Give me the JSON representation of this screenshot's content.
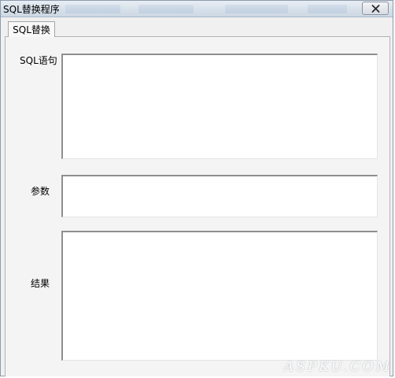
{
  "window": {
    "title": "SQL替换程序"
  },
  "tabs": [
    {
      "label": "SQL替换",
      "selected": true
    }
  ],
  "form": {
    "sql_label": "SQL语句",
    "sql_value": "",
    "params_label": "参数",
    "params_value": "",
    "result_label": "结果",
    "result_value": ""
  },
  "icons": {
    "close": "close-icon"
  },
  "watermark": {
    "text": "ASPKU.COM"
  }
}
